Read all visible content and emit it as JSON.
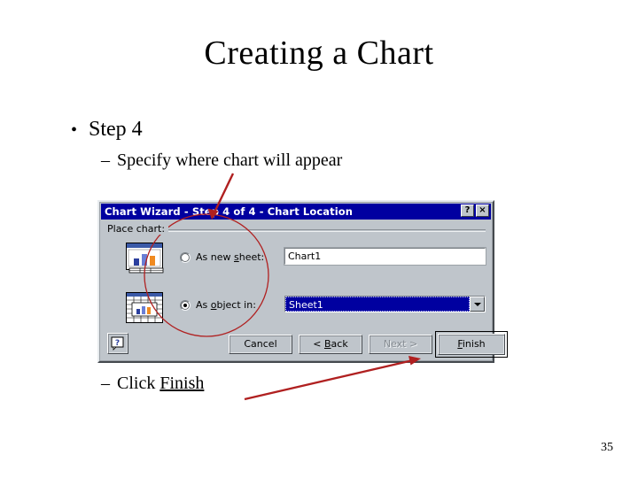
{
  "slide": {
    "title": "Creating a Chart",
    "page_number": "35",
    "bullets": [
      {
        "level": 1,
        "marker": "•",
        "text": "Step 4"
      },
      {
        "level": 2,
        "marker": "–",
        "text": "Specify where chart will appear"
      },
      {
        "level": 2,
        "marker": "–",
        "text_prefix": "Click ",
        "text_underlined": "Finish"
      }
    ]
  },
  "dialog": {
    "title": "Chart Wizard - Step 4 of 4 - Chart Location",
    "titlebar_color": "#0000a0",
    "face_color": "#bfc5cb",
    "title_buttons": [
      {
        "name": "help-icon",
        "glyph": "?"
      },
      {
        "name": "close-icon",
        "glyph": "×"
      }
    ],
    "group": {
      "label": "Place chart:"
    },
    "options": [
      {
        "id": "as-new-sheet",
        "label_before": "As new ",
        "label_accel": "s",
        "label_after": "heet:",
        "checked": false,
        "icon": "chart-sheet-icon"
      },
      {
        "id": "as-object-in",
        "label_before": "As ",
        "label_accel": "o",
        "label_after": "bject in:",
        "checked": true,
        "icon": "worksheet-with-chart-icon"
      }
    ],
    "fields": {
      "chart_name": {
        "value": "Chart1",
        "placeholder": "Chart1"
      },
      "sheet_combo": {
        "value": "Sheet1",
        "selected": true,
        "arrow": "chevron-down-icon"
      }
    },
    "buttons": [
      {
        "id": "help",
        "label": "?",
        "enabled": true,
        "default": false
      },
      {
        "id": "cancel",
        "label": "Cancel",
        "accel": "",
        "enabled": true,
        "default": false
      },
      {
        "id": "back",
        "label_before": "< ",
        "accel": "B",
        "label_after": "ack",
        "enabled": true,
        "default": false
      },
      {
        "id": "next",
        "label_before": "Next ",
        "accel": "",
        "label_after": ">",
        "enabled": false,
        "default": false
      },
      {
        "id": "finish",
        "label_before": "",
        "accel": "F",
        "label_after": "inish",
        "enabled": true,
        "default": true
      }
    ]
  },
  "annotations": {
    "color": "#b02020",
    "items": [
      {
        "name": "highlight-ellipse",
        "shape": "ellipse",
        "target": "radio-button-group"
      },
      {
        "name": "pointer-arrow-top",
        "shape": "arrow",
        "target": "chart-location-options"
      },
      {
        "name": "pointer-arrow-bottom",
        "shape": "arrow",
        "target": "finish-button"
      }
    ]
  }
}
